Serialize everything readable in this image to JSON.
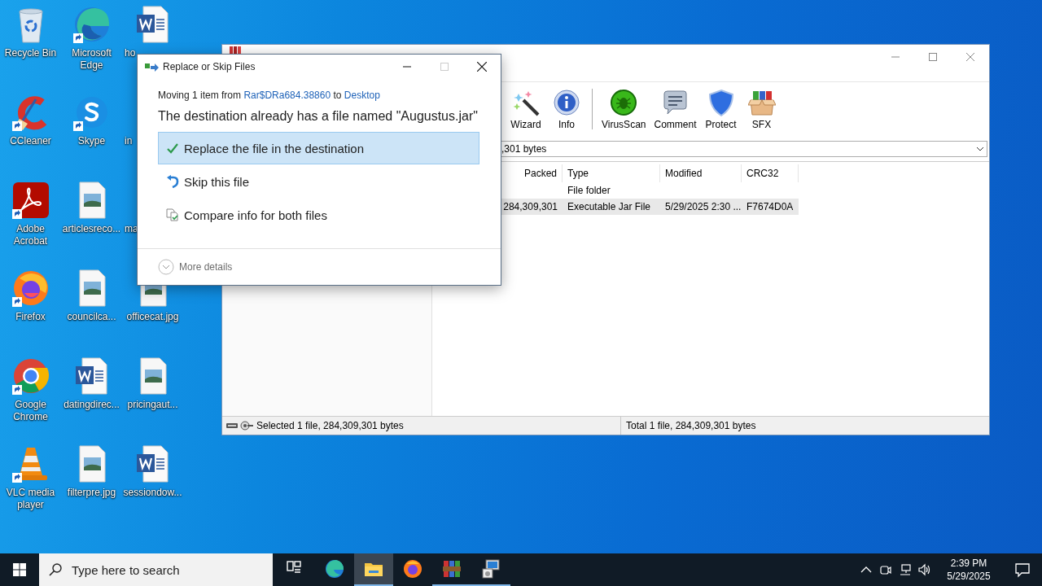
{
  "desktop_icons": [
    {
      "label": "Recycle Bin",
      "kind": "bin",
      "shortcut": false,
      "cut": false
    },
    {
      "label": "CCleaner",
      "kind": "ccleaner",
      "shortcut": true,
      "cut": false
    },
    {
      "label": "Adobe Acrobat",
      "kind": "acrobat",
      "shortcut": true,
      "cut": false
    },
    {
      "label": "Firefox",
      "kind": "firefox",
      "shortcut": true,
      "cut": false
    },
    {
      "label": "Google Chrome",
      "kind": "chrome",
      "shortcut": true,
      "cut": false
    },
    {
      "label": "VLC media player",
      "kind": "vlc",
      "shortcut": true,
      "cut": false
    },
    {
      "label": "Microsoft Edge",
      "kind": "edge",
      "shortcut": true,
      "cut": false
    },
    {
      "label": "Skype",
      "kind": "skype",
      "shortcut": true,
      "cut": false
    },
    {
      "label": "articlesreco...",
      "kind": "image",
      "shortcut": false,
      "cut": false
    },
    {
      "label": "councilca...",
      "kind": "image",
      "shortcut": false,
      "cut": false
    },
    {
      "label": "datingdirec...",
      "kind": "word",
      "shortcut": false,
      "cut": false
    },
    {
      "label": "filterpre.jpg",
      "kind": "image",
      "shortcut": false,
      "cut": false
    },
    {
      "label": "ho",
      "kind": "word",
      "shortcut": false,
      "cut": true
    },
    {
      "label": "in",
      "kind": "none",
      "cut": true
    },
    {
      "label": "ma",
      "kind": "none",
      "cut": true
    },
    {
      "label": "officecat.jpg",
      "kind": "image",
      "shortcut": false,
      "cut": false
    },
    {
      "label": "pricingaut...",
      "kind": "image",
      "shortcut": false,
      "cut": false
    },
    {
      "label": "sessiondow...",
      "kind": "word",
      "shortcut": false,
      "cut": false
    }
  ],
  "archive_window": {
    "toolbar": [
      {
        "kind": "wizard",
        "label": "Wizard"
      },
      {
        "kind": "info",
        "label": "Info"
      },
      {
        "kind": "separator"
      },
      {
        "kind": "virusscan",
        "label": "VirusScan"
      },
      {
        "kind": "comment",
        "label": "Comment"
      },
      {
        "kind": "protect",
        "label": "Protect"
      },
      {
        "kind": "sfx",
        "label": "SFX"
      }
    ],
    "address": ",301 bytes",
    "columns": [
      "Packed",
      "Type",
      "Modified",
      "CRC32"
    ],
    "rows": [
      {
        "type": "File folder",
        "selected": false
      },
      {
        "packed": "284,309,301",
        "type": "Executable Jar File",
        "modified": "5/29/2025 2:30 ...",
        "crc32": "F7674D0A",
        "selected": true
      }
    ],
    "status_left": "Selected 1 file, 284,309,301 bytes",
    "status_right": "Total 1 file, 284,309,301 bytes"
  },
  "dialog": {
    "title": "Replace or Skip Files",
    "move_info": {
      "prefix": "Moving 1 item from",
      "source": "Rar$DRa684.38860",
      "middle": "to",
      "destination": "Desktop"
    },
    "message": "The destination already has a file named \"Augustus.jar\"",
    "options": [
      {
        "kind": "replace",
        "label": "Replace the file in the destination",
        "selected": true
      },
      {
        "kind": "skip",
        "label": "Skip this file",
        "selected": false
      },
      {
        "kind": "compare",
        "label": "Compare info for both files",
        "selected": false
      }
    ],
    "more_details": "More details"
  },
  "taskbar": {
    "search_placeholder": "Type here to search",
    "apps": [
      {
        "kind": "task-view",
        "active": false,
        "running": false
      },
      {
        "kind": "edge",
        "active": false,
        "running": false
      },
      {
        "kind": "explorer",
        "active": true,
        "running": true
      },
      {
        "kind": "firefox",
        "active": false,
        "running": false
      },
      {
        "kind": "winrar",
        "active": false,
        "running": true
      },
      {
        "kind": "installer",
        "active": false,
        "running": true
      }
    ],
    "clock": {
      "time": "2:39 PM",
      "date": "5/29/2025"
    }
  }
}
